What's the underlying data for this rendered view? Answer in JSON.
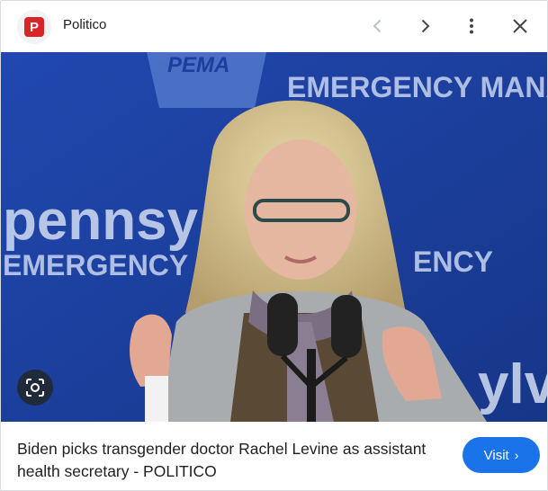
{
  "header": {
    "favicon_letter": "P",
    "source_name": "Politico",
    "prev_icon": "chevron-left-icon",
    "next_icon": "chevron-right-icon",
    "more_icon": "more-vert-icon",
    "close_icon": "close-icon"
  },
  "image": {
    "backdrop_texts": [
      "PEMA",
      "EMERGENCY MANA",
      "pennsy",
      "EMERGENCY",
      "ENCY",
      "ylv"
    ],
    "lens_icon": "lens-search-icon"
  },
  "caption": {
    "text": "Biden picks transgender doctor Rachel Levine as assistant health secretary - POLITICO"
  },
  "visit_button": {
    "label": "Visit",
    "chevron": "›",
    "color": "#1a73e8"
  },
  "colors": {
    "brand_red": "#d9252a",
    "backdrop_blue": "#1c3e9e"
  }
}
